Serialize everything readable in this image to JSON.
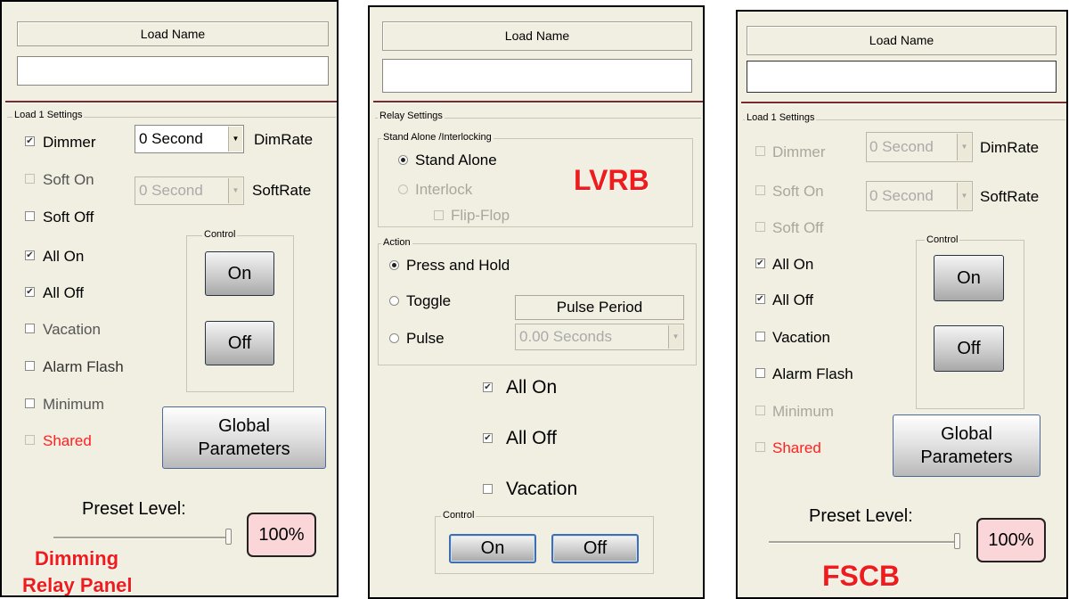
{
  "panel1": {
    "load_name_label": "Load Name",
    "load_name_value": "",
    "settings_title": "Load 1 Settings",
    "dimmer": {
      "label": "Dimmer",
      "checked": true
    },
    "dim_select": "0 Second",
    "dim_rate_label": "DimRate",
    "soft_on": {
      "label": "Soft On",
      "checked": false
    },
    "soft_select": "0 Second",
    "soft_rate_label": "SoftRate",
    "soft_off": {
      "label": "Soft Off",
      "checked": false
    },
    "all_on": {
      "label": "All On",
      "checked": true
    },
    "all_off": {
      "label": "All Off",
      "checked": true
    },
    "vacation": {
      "label": "Vacation",
      "checked": false
    },
    "alarm_flash": {
      "label": "Alarm Flash",
      "checked": false
    },
    "minimum": {
      "label": "Minimum",
      "checked": false
    },
    "shared": {
      "label": "Shared",
      "checked": false
    },
    "control_title": "Control",
    "on_button": "On",
    "off_button": "Off",
    "global_button": "Global\nParameters",
    "preset_label": "Preset Level:",
    "preset_value": "100%",
    "preset_level_fraction": 1.0,
    "caption_line1": "Dimming",
    "caption_line2": "Relay Panel"
  },
  "panel2": {
    "load_name_label": "Load Name",
    "load_name_value": "",
    "settings_title": "Relay Settings",
    "standalone_group_title": "Stand Alone /Interlocking",
    "stand_alone": {
      "label": "Stand Alone",
      "selected": true
    },
    "interlock": {
      "label": "Interlock",
      "selected": false
    },
    "flip_flop": {
      "label": "Flip-Flop",
      "checked": false
    },
    "caption": "LVRB",
    "action_title": "Action",
    "press_hold": {
      "label": "Press and Hold",
      "selected": true
    },
    "toggle": {
      "label": "Toggle",
      "selected": false
    },
    "pulse": {
      "label": "Pulse",
      "selected": false
    },
    "pulse_period_label": "Pulse Period",
    "pulse_period_value": "0.00  Seconds",
    "all_on": {
      "label": "All On",
      "checked": true
    },
    "all_off": {
      "label": "All Off",
      "checked": true
    },
    "vacation": {
      "label": "Vacation",
      "checked": false
    },
    "control_title": "Control",
    "on_button": "On",
    "off_button": "Off"
  },
  "panel3": {
    "load_name_label": "Load Name",
    "load_name_value": "",
    "settings_title": "Load 1 Settings",
    "dimmer": {
      "label": "Dimmer",
      "checked": false
    },
    "dim_select": "0 Second",
    "dim_rate_label": "DimRate",
    "soft_on": {
      "label": "Soft On",
      "checked": false
    },
    "soft_select": "0 Second",
    "soft_rate_label": "SoftRate",
    "soft_off": {
      "label": "Soft Off",
      "checked": false
    },
    "all_on": {
      "label": "All On",
      "checked": true
    },
    "all_off": {
      "label": "All Off",
      "checked": true
    },
    "vacation": {
      "label": "Vacation",
      "checked": false
    },
    "alarm_flash": {
      "label": "Alarm Flash",
      "checked": false
    },
    "minimum": {
      "label": "Minimum",
      "checked": false
    },
    "shared": {
      "label": "Shared",
      "checked": false
    },
    "control_title": "Control",
    "on_button": "On",
    "off_button": "Off",
    "global_button": "Global\nParameters",
    "preset_label": "Preset Level:",
    "preset_value": "100%",
    "preset_level_fraction": 1.0,
    "caption": "FSCB"
  },
  "colors": {
    "panel_bg": "#f1efe2",
    "rule": "#7a2a2a",
    "caption_red": "#ee1c1c",
    "shared_red": "#ff2020",
    "preset_pink": "#fbd6d9"
  },
  "icons": {
    "checkbox_mark": "✔",
    "dropdown_arrow": "▼"
  }
}
